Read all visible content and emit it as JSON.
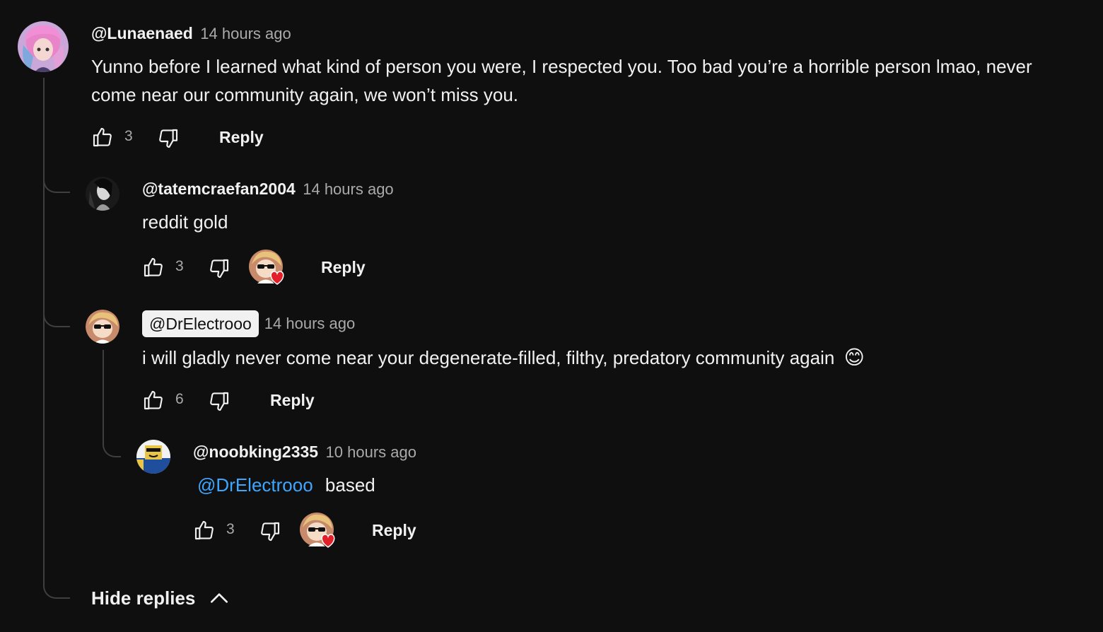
{
  "comments": [
    {
      "author": "@Lunaenaed",
      "time": "14 hours ago",
      "text_line1": "Yunno before I learned what kind of person you were, I respected you. Too bad you’re a horrible person lmao, never",
      "text_line2": "come near our community again, we won’t miss you.",
      "likes": "3",
      "reply_label": "Reply",
      "avatar_icon": "anime-girl-avatar"
    },
    {
      "author": "@tatemcraefan2004",
      "time": "14 hours ago",
      "text": "reddit gold",
      "likes": "3",
      "reply_label": "Reply",
      "creator_heart": true,
      "avatar_icon": "dark-figure-avatar"
    },
    {
      "author": "@DrElectrooo",
      "time": "14 hours ago",
      "text": "i will gladly never come near your degenerate-filled, filthy, predatory community again",
      "emoji": "😊",
      "likes": "6",
      "reply_label": "Reply",
      "is_creator": true,
      "avatar_icon": "cartoon-blonde-sunglasses-avatar"
    },
    {
      "author": "@noobking2335",
      "time": "10 hours ago",
      "mention": "@DrElectrooo",
      "text": "based",
      "likes": "3",
      "reply_label": "Reply",
      "creator_heart": true,
      "avatar_icon": "roblox-noob-avatar"
    }
  ],
  "hide_replies_label": "Hide replies",
  "colors": {
    "background": "#0f0f0f",
    "text": "#f1f1f1",
    "secondary": "#aaaaaa",
    "mention": "#3ea6ff",
    "heart": "#e3202a"
  }
}
